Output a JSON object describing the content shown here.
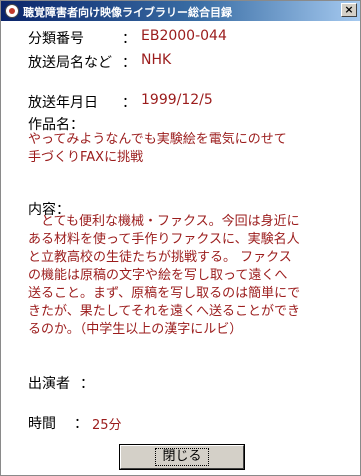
{
  "window": {
    "title": "聴覚障害者向け映像ライブラリー総合目録",
    "close_glyph": "×"
  },
  "fields": {
    "category_number": {
      "label": "分類番号",
      "separator": "：",
      "value": "EB2000-044"
    },
    "broadcaster": {
      "label": "放送局名など",
      "separator": "：",
      "value": "NHK"
    },
    "broadcast_date": {
      "label": "放送年月日",
      "separator": "：",
      "value": "1999/12/5"
    },
    "performers": {
      "label": "出演者",
      "separator": "：",
      "value": ""
    },
    "duration": {
      "label": "時間",
      "separator": "：",
      "value": "25分"
    }
  },
  "work": {
    "label": "作品名：",
    "lines": [
      "やってみようなんでも実験絵を電気にのせて",
      "手づくりFAXに挑戦"
    ]
  },
  "content": {
    "label": "内容：",
    "lines": [
      "　とても便利な機械・ファクス。今回は身近に",
      "ある材料を使って手作りファクスに、実験名人",
      "と立教高校の生徒たちが挑戦する。 ファクス",
      "の機能は原稿の文字や絵を写し取って遠くへ",
      "送ること。まず、原稿を写し取るのは簡単にで",
      "きたが、果たしてそれを遠くへ送ることができ",
      "るのか。（中学生以上の漢字にルビ）"
    ]
  },
  "buttons": {
    "close_label": "閉じる"
  }
}
